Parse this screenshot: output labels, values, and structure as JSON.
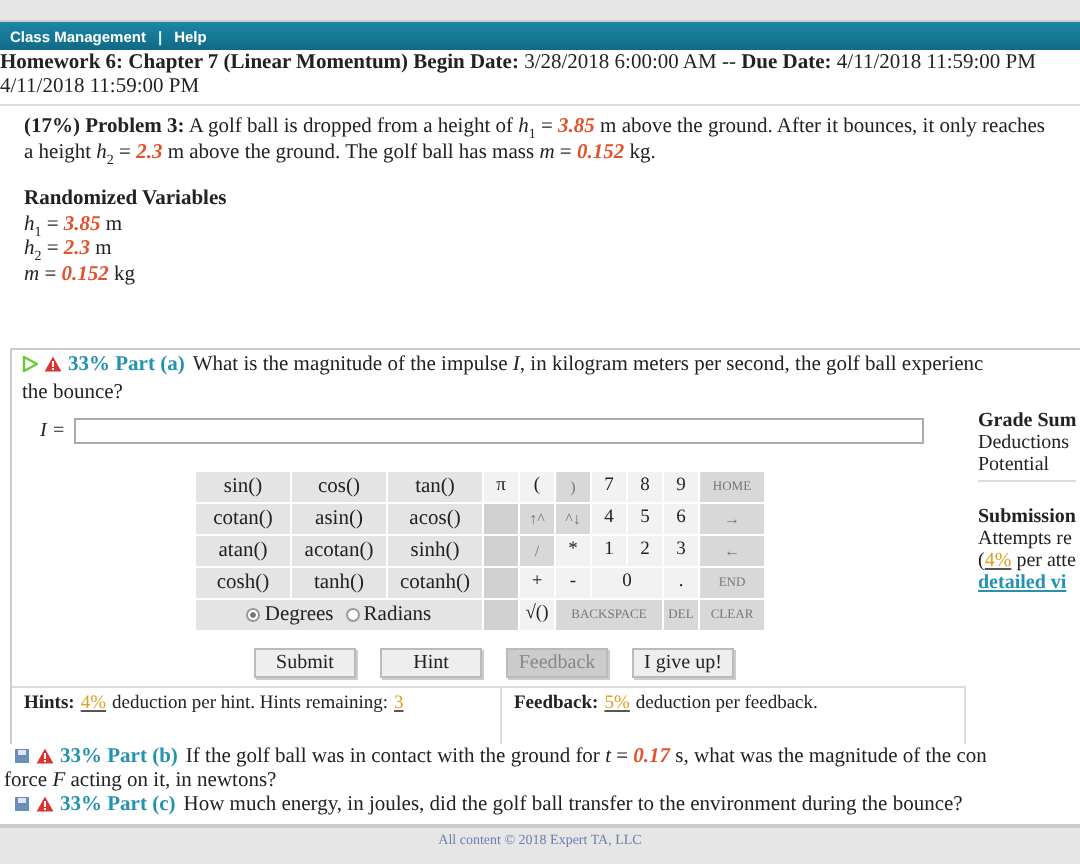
{
  "nav": {
    "items": [
      "Class Management",
      "Help"
    ],
    "separator": "|"
  },
  "header": {
    "segments": [
      {
        "kind": "bold",
        "text": "Homework 6: Chapter 7 (Linear Momentum) Begin Date:"
      },
      {
        "kind": "text",
        "text": " 3/28/2018 6:00:00 AM -- "
      },
      {
        "kind": "bold",
        "text": "Due Date:"
      },
      {
        "kind": "text",
        "text": " 4/11/2018 11:59:00 PM"
      }
    ],
    "line2": "4/11/2018 11:59:00 PM"
  },
  "problem": {
    "segments": [
      {
        "kind": "bold",
        "text": "(17%) Problem 3:"
      },
      {
        "kind": "text",
        "text": " A golf ball is dropped from a height of "
      },
      {
        "kind": "var",
        "text": "h",
        "sub": "1"
      },
      {
        "kind": "text",
        "text": " = "
      },
      {
        "kind": "value",
        "text": "3.85"
      },
      {
        "kind": "text",
        "text": " m above the ground. After it bounces, it only reaches a height "
      },
      {
        "kind": "var",
        "text": "h",
        "sub": "2"
      },
      {
        "kind": "text",
        "text": " = "
      },
      {
        "kind": "value",
        "text": "2.3"
      },
      {
        "kind": "text",
        "text": " m above the ground. The golf ball has mass "
      },
      {
        "kind": "var",
        "text": "m"
      },
      {
        "kind": "text",
        "text": " = "
      },
      {
        "kind": "value",
        "text": "0.152"
      },
      {
        "kind": "text",
        "text": " kg."
      }
    ]
  },
  "randomized": {
    "title": "Randomized Variables",
    "variables": [
      [
        {
          "kind": "var",
          "text": "h",
          "sub": "1"
        },
        {
          "kind": "text",
          "text": " = "
        },
        {
          "kind": "value",
          "text": "3.85"
        },
        {
          "kind": "text",
          "text": " m"
        }
      ],
      [
        {
          "kind": "var",
          "text": "h",
          "sub": "2"
        },
        {
          "kind": "text",
          "text": " = "
        },
        {
          "kind": "value",
          "text": "2.3"
        },
        {
          "kind": "text",
          "text": " m"
        }
      ],
      [
        {
          "kind": "var",
          "text": "m"
        },
        {
          "kind": "text",
          "text": " = "
        },
        {
          "kind": "value",
          "text": "0.152"
        },
        {
          "kind": "text",
          "text": " kg"
        }
      ]
    ]
  },
  "parts": [
    {
      "expanded": true,
      "percent": "33% Part (a)",
      "question": [
        {
          "kind": "text",
          "text": "What is the magnitude of the impulse "
        },
        {
          "kind": "var",
          "text": "I"
        },
        {
          "kind": "text",
          "text": ", in kilogram meters per second, the golf ball experienc"
        }
      ],
      "question_line2": "the bounce?"
    },
    {
      "expanded": false,
      "percent": "33% Part (b)",
      "question": [
        {
          "kind": "text",
          "text": "If the golf ball was in contact with the ground for "
        },
        {
          "kind": "var",
          "text": "t"
        },
        {
          "kind": "text",
          "text": " = "
        },
        {
          "kind": "value",
          "text": "0.17"
        },
        {
          "kind": "text",
          "text": " s, what was the magnitude of the con"
        }
      ],
      "question_line2": [
        {
          "kind": "text",
          "text": "force "
        },
        {
          "kind": "var",
          "text": "F"
        },
        {
          "kind": "text",
          "text": " acting on it, in newtons?"
        }
      ]
    },
    {
      "expanded": false,
      "percent": "33% Part (c)",
      "question": [
        {
          "kind": "text",
          "text": "How much energy, in joules, did the golf ball transfer to the environment during the bounce?"
        }
      ]
    }
  ],
  "answer": {
    "label": "I ="
  },
  "keypad": {
    "functions": [
      "sin()",
      "cos()",
      "tan()",
      "cotan()",
      "asin()",
      "acos()",
      "atan()",
      "acotan()",
      "sinh()",
      "cosh()",
      "tanh()",
      "cotanh()"
    ],
    "angle_modes": [
      {
        "label": "Degrees",
        "selected": true
      },
      {
        "label": "Radians",
        "selected": false
      }
    ],
    "keys": [
      {
        "kind": "key",
        "label": "π",
        "disabled": false
      },
      {
        "kind": "key",
        "label": "(",
        "disabled": false
      },
      {
        "kind": "key",
        "label": ")",
        "disabled": true
      },
      {
        "kind": "key",
        "label": "7",
        "disabled": false
      },
      {
        "kind": "key",
        "label": "8",
        "disabled": false
      },
      {
        "kind": "key",
        "label": "9",
        "disabled": false
      },
      {
        "kind": "key",
        "label": "HOME",
        "disabled": true
      },
      {
        "kind": "blank"
      },
      {
        "kind": "key",
        "label": "↑^",
        "disabled": true
      },
      {
        "kind": "key",
        "label": "^↓",
        "disabled": true
      },
      {
        "kind": "key",
        "label": "4",
        "disabled": false
      },
      {
        "kind": "key",
        "label": "5",
        "disabled": false
      },
      {
        "kind": "key",
        "label": "6",
        "disabled": false
      },
      {
        "kind": "key",
        "label": "→",
        "disabled": true
      },
      {
        "kind": "blank"
      },
      {
        "kind": "key",
        "label": "/",
        "disabled": true
      },
      {
        "kind": "key",
        "label": "*",
        "disabled": false
      },
      {
        "kind": "key",
        "label": "1",
        "disabled": false
      },
      {
        "kind": "key",
        "label": "2",
        "disabled": false
      },
      {
        "kind": "key",
        "label": "3",
        "disabled": false
      },
      {
        "kind": "key",
        "label": "←",
        "disabled": true
      },
      {
        "kind": "blank"
      },
      {
        "kind": "key",
        "label": "+",
        "disabled": false
      },
      {
        "kind": "key",
        "label": "-",
        "disabled": false
      },
      {
        "kind": "wide",
        "label": "0",
        "disabled": false
      },
      {
        "kind": "key",
        "label": ".",
        "disabled": false
      },
      {
        "kind": "key",
        "label": "END",
        "disabled": true
      },
      {
        "kind": "blank"
      },
      {
        "kind": "key",
        "label": "√()",
        "disabled": false
      },
      {
        "kind": "triple",
        "label": "BACKSPACE",
        "disabled": true
      },
      {
        "kind": "key",
        "label": "DEL",
        "disabled": true
      },
      {
        "kind": "key",
        "label": "CLEAR",
        "disabled": true
      }
    ]
  },
  "buttons": [
    {
      "label": "Submit",
      "disabled": false
    },
    {
      "label": "Hint",
      "disabled": false
    },
    {
      "label": "Feedback",
      "disabled": true
    },
    {
      "label": "I give up!",
      "disabled": false
    }
  ],
  "hints": {
    "label": "Hints:",
    "percent": "4%",
    "text": "deduction per hint. Hints remaining:",
    "remaining": "3"
  },
  "feedback": {
    "label": "Feedback:",
    "percent": "5%",
    "text": "deduction per feedback."
  },
  "grade_summary": {
    "title": "Grade Sum",
    "rows": [
      "Deductions",
      "Potential"
    ]
  },
  "submissions": {
    "title": "Submission",
    "attempts": "Attempts re",
    "penalty": [
      {
        "kind": "text",
        "text": "("
      },
      {
        "kind": "pct",
        "text": "4%"
      },
      {
        "kind": "text",
        "text": " per atte"
      }
    ],
    "link": "detailed vi"
  },
  "footer": "All content © 2018 Expert TA, LLC"
}
